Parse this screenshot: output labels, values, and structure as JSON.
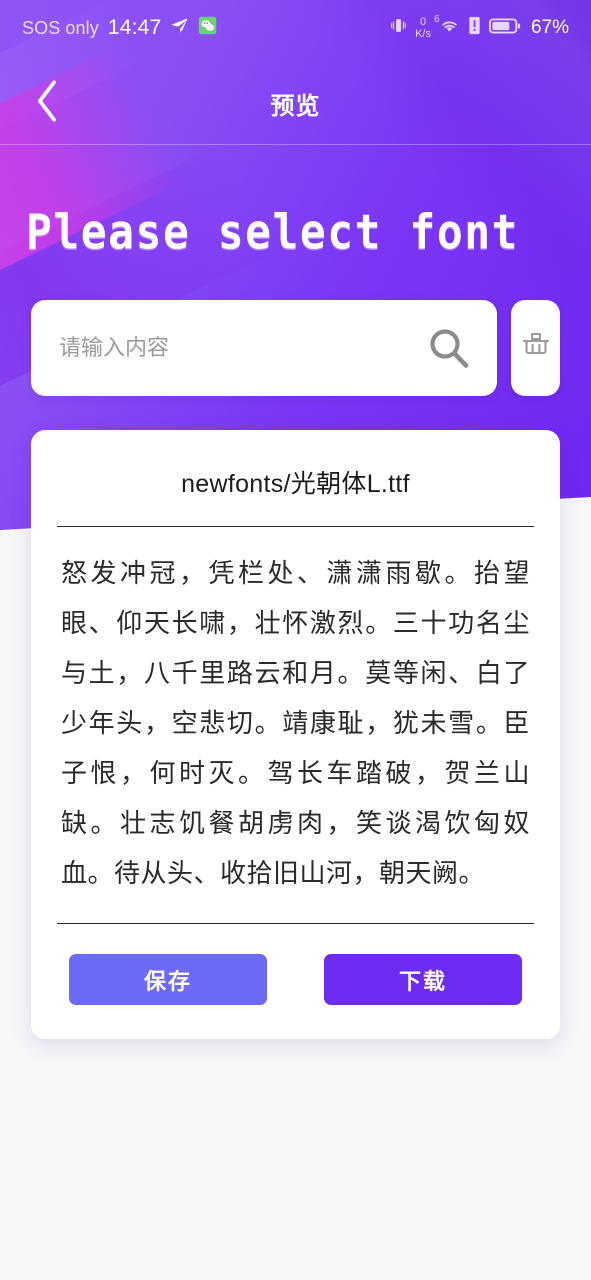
{
  "statusbar": {
    "carrier": "SOS only",
    "clock": "14:47",
    "location_icon": "navigation-arrow-icon",
    "app_icon": "wechat-badge-icon",
    "vibrate_icon": "vibrate-icon",
    "netspeed_value": "0",
    "netspeed_unit": "K/s",
    "wifi_icon": "wifi-icon",
    "wifi_generation": "6",
    "sim_icon": "sim-alert-icon",
    "battery_icon": "battery-icon",
    "battery_percent": "67%"
  },
  "navbar": {
    "back_icon": "chevron-left-icon",
    "title": "预览"
  },
  "hero": {
    "heading": "Please select font",
    "gradient_start": "#8F55F6",
    "gradient_end": "#6F25F2",
    "accent_magenta": "#D648EC"
  },
  "search": {
    "placeholder": "请输入内容",
    "value": "",
    "search_icon": "search-icon",
    "clear_icon": "broom-clear-icon"
  },
  "preview_card": {
    "font_name": "newfonts/光朝体L.ttf",
    "poem": "怒发冲冠，凭栏处、潇潇雨歇。抬望眼、仰天长啸，壮怀激烈。三十功名尘与土，八千里路云和月。莫等闲、白了少年头，空悲切。靖康耻，犹未雪。臣子恨，何时灭。驾长车踏破，贺兰山缺。壮志饥餐胡虏肉，笑谈渴饮匈奴血。待从头、收拾旧山河，朝天阙。",
    "save_label": "保存",
    "download_label": "下载",
    "save_color": "#6D6AF7",
    "download_color": "#6C2CF3"
  }
}
